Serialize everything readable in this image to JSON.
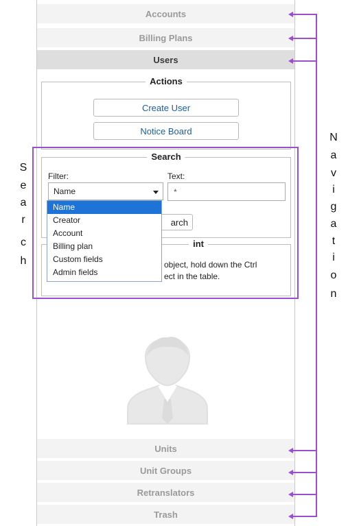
{
  "navigation": {
    "top_items": [
      {
        "label": "Accounts",
        "active": false
      },
      {
        "label": "Billing Plans",
        "active": false
      },
      {
        "label": "Users",
        "active": true
      }
    ],
    "bottom_items": [
      {
        "label": "Units"
      },
      {
        "label": "Unit Groups"
      },
      {
        "label": "Retranslators"
      },
      {
        "label": "Trash"
      }
    ]
  },
  "actions": {
    "legend": "Actions",
    "create_user": "Create User",
    "notice_board": "Notice Board"
  },
  "search": {
    "legend": "Search",
    "filter_label": "Filter:",
    "filter_value": "Name",
    "text_label": "Text:",
    "text_value": "*",
    "search_button_visible": "arch",
    "filter_options": [
      "Name",
      "Creator",
      "Account",
      "Billing plan",
      "Custom fields",
      "Admin fields"
    ]
  },
  "hint": {
    "legend_visible": "int",
    "line1_visible": "object, hold down the Ctrl",
    "line2_visible": "ect in the table."
  },
  "annotations": {
    "search_letters": [
      "S",
      "e",
      "a",
      "r",
      "c",
      "h"
    ],
    "navigation_letters": [
      "N",
      "a",
      "v",
      "i",
      "g",
      "a",
      "t",
      "i",
      "o",
      "n"
    ],
    "color": "#9b4fd0"
  },
  "icons": {
    "placeholder": "user-placeholder-icon",
    "dropdown": "chevron-down-icon"
  }
}
